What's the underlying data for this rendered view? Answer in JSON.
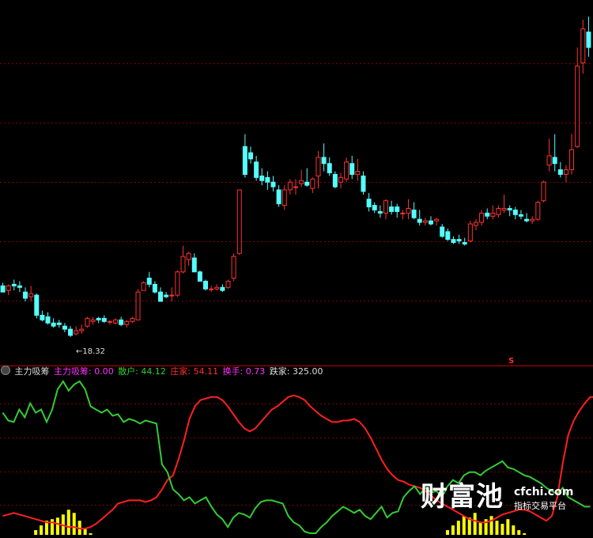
{
  "indicator_label": "主力吸筹",
  "legend": {
    "main_label": "主力吸筹: 0.00",
    "retail_label": "散户: 44.12",
    "dealer_label": "庄家: 54.11",
    "turnover_label": "换手: 0.73",
    "trap_label": "跌家: 325.00"
  },
  "low_marker": "←18.32",
  "signal_marker": "S",
  "watermark": {
    "brand_cn": "财富池",
    "brand_en": "cfchi.com",
    "tagline": "指标交易平台"
  },
  "colors": {
    "up": "#ff3232",
    "down": "#54ffff",
    "retail": "#33cc33",
    "dealer": "#ff2020",
    "bars": "#ffff00",
    "grid": "#800000"
  },
  "chart_data": [
    {
      "type": "candlestick",
      "title": "",
      "ylim": [
        17.5,
        29.0
      ],
      "annotation_low": 18.32,
      "candles": [
        [
          19.92,
          20.02,
          19.72,
          19.72
        ],
        [
          19.77,
          19.97,
          19.62,
          19.92
        ],
        [
          19.97,
          20.12,
          19.77,
          19.92
        ],
        [
          19.92,
          20.07,
          19.72,
          19.87
        ],
        [
          19.72,
          19.87,
          19.42,
          19.52
        ],
        [
          19.57,
          19.92,
          19.42,
          19.67
        ],
        [
          19.62,
          19.67,
          18.87,
          18.97
        ],
        [
          18.97,
          19.12,
          18.77,
          18.82
        ],
        [
          18.92,
          19.07,
          18.67,
          18.72
        ],
        [
          18.72,
          18.87,
          18.57,
          18.62
        ],
        [
          18.72,
          18.82,
          18.57,
          18.67
        ],
        [
          18.62,
          18.72,
          18.42,
          18.52
        ],
        [
          18.52,
          18.62,
          18.27,
          18.32
        ],
        [
          18.37,
          18.62,
          18.32,
          18.47
        ],
        [
          18.47,
          18.67,
          18.37,
          18.52
        ],
        [
          18.62,
          18.92,
          18.57,
          18.87
        ],
        [
          18.77,
          18.92,
          18.67,
          18.82
        ],
        [
          18.87,
          18.92,
          18.72,
          18.82
        ],
        [
          18.87,
          18.97,
          18.72,
          18.77
        ],
        [
          18.77,
          18.82,
          18.67,
          18.77
        ],
        [
          18.72,
          18.87,
          18.67,
          18.82
        ],
        [
          18.82,
          18.92,
          18.62,
          18.67
        ],
        [
          18.67,
          18.82,
          18.57,
          18.77
        ],
        [
          18.77,
          18.92,
          18.72,
          18.87
        ],
        [
          18.82,
          19.82,
          18.82,
          19.72
        ],
        [
          19.77,
          20.07,
          19.77,
          20.02
        ],
        [
          20.17,
          20.37,
          19.87,
          19.97
        ],
        [
          19.97,
          20.07,
          19.67,
          19.72
        ],
        [
          19.72,
          19.87,
          19.42,
          19.42
        ],
        [
          19.62,
          19.72,
          19.52,
          19.57
        ],
        [
          19.62,
          19.87,
          19.42,
          19.62
        ],
        [
          19.62,
          20.42,
          19.57,
          20.37
        ],
        [
          20.37,
          21.22,
          20.32,
          20.87
        ],
        [
          20.77,
          21.02,
          20.57,
          20.97
        ],
        [
          20.82,
          20.97,
          20.47,
          20.37
        ],
        [
          20.37,
          20.42,
          20.07,
          20.07
        ],
        [
          20.07,
          20.12,
          19.77,
          19.82
        ],
        [
          19.82,
          19.92,
          19.72,
          19.82
        ],
        [
          19.82,
          19.97,
          19.77,
          19.87
        ],
        [
          19.87,
          19.97,
          19.72,
          19.77
        ],
        [
          19.87,
          20.12,
          19.82,
          20.07
        ],
        [
          20.17,
          20.97,
          20.07,
          20.87
        ],
        [
          20.97,
          23.02,
          20.92,
          23.02
        ],
        [
          24.42,
          24.82,
          23.42,
          23.52
        ],
        [
          24.22,
          24.42,
          23.87,
          24.02
        ],
        [
          23.92,
          24.12,
          23.32,
          23.42
        ],
        [
          23.47,
          23.72,
          23.17,
          23.32
        ],
        [
          23.42,
          23.62,
          23.02,
          23.27
        ],
        [
          23.27,
          23.47,
          22.97,
          23.12
        ],
        [
          23.02,
          23.17,
          22.47,
          22.57
        ],
        [
          22.52,
          23.17,
          22.37,
          23.02
        ],
        [
          23.02,
          23.37,
          22.87,
          23.27
        ],
        [
          23.12,
          23.37,
          22.87,
          23.12
        ],
        [
          23.22,
          23.67,
          23.12,
          23.32
        ],
        [
          23.27,
          23.72,
          23.12,
          23.17
        ],
        [
          23.07,
          23.42,
          22.92,
          23.37
        ],
        [
          23.47,
          24.27,
          23.07,
          24.07
        ],
        [
          24.07,
          24.52,
          23.62,
          23.87
        ],
        [
          23.87,
          24.07,
          23.47,
          23.57
        ],
        [
          23.52,
          23.62,
          23.07,
          23.12
        ],
        [
          23.27,
          23.57,
          23.07,
          23.42
        ],
        [
          23.37,
          24.07,
          23.27,
          23.92
        ],
        [
          23.87,
          24.12,
          23.37,
          23.52
        ],
        [
          23.52,
          24.02,
          23.32,
          23.62
        ],
        [
          23.47,
          23.62,
          22.87,
          22.97
        ],
        [
          22.72,
          22.92,
          22.32,
          22.47
        ],
        [
          22.52,
          22.62,
          22.27,
          22.37
        ],
        [
          22.32,
          22.52,
          22.12,
          22.27
        ],
        [
          22.27,
          22.72,
          22.07,
          22.67
        ],
        [
          22.47,
          22.67,
          22.22,
          22.32
        ],
        [
          22.47,
          22.57,
          22.12,
          22.32
        ],
        [
          22.27,
          22.37,
          22.07,
          22.27
        ],
        [
          22.27,
          22.72,
          22.07,
          22.42
        ],
        [
          22.37,
          22.62,
          22.07,
          22.12
        ],
        [
          22.07,
          22.37,
          21.87,
          21.97
        ],
        [
          21.97,
          22.12,
          21.87,
          22.02
        ],
        [
          22.02,
          22.17,
          21.87,
          21.92
        ],
        [
          22.02,
          22.12,
          21.87,
          22.07
        ],
        [
          21.82,
          21.92,
          21.47,
          21.52
        ],
        [
          21.67,
          21.77,
          21.37,
          21.42
        ],
        [
          21.42,
          21.52,
          21.27,
          21.32
        ],
        [
          21.42,
          21.57,
          21.27,
          21.37
        ],
        [
          21.32,
          21.47,
          21.22,
          21.27
        ],
        [
          21.37,
          22.02,
          21.32,
          21.92
        ],
        [
          21.87,
          22.07,
          21.72,
          21.97
        ],
        [
          21.97,
          22.37,
          21.87,
          22.27
        ],
        [
          22.27,
          22.42,
          22.07,
          22.17
        ],
        [
          22.17,
          22.52,
          22.07,
          22.27
        ],
        [
          22.22,
          22.52,
          22.12,
          22.42
        ],
        [
          22.37,
          22.87,
          22.27,
          22.42
        ],
        [
          22.42,
          22.52,
          22.17,
          22.37
        ],
        [
          22.37,
          22.47,
          22.07,
          22.22
        ],
        [
          22.22,
          22.37,
          22.07,
          22.17
        ],
        [
          22.07,
          22.27,
          21.97,
          22.02
        ],
        [
          22.02,
          22.17,
          21.92,
          22.07
        ],
        [
          22.07,
          22.67,
          22.02,
          22.62
        ],
        [
          22.67,
          23.32,
          22.62,
          23.27
        ],
        [
          23.82,
          24.67,
          23.62,
          24.12
        ],
        [
          24.07,
          24.82,
          23.62,
          23.87
        ],
        [
          23.67,
          23.92,
          23.42,
          23.52
        ],
        [
          23.52,
          23.82,
          23.27,
          23.67
        ],
        [
          23.67,
          24.82,
          23.52,
          24.32
        ],
        [
          24.42,
          27.62,
          24.37,
          27.02
        ],
        [
          27.12,
          28.52,
          26.77,
          28.22
        ],
        [
          28.12,
          28.62,
          27.32,
          27.62
        ]
      ]
    },
    {
      "type": "line",
      "title": "主力吸筹",
      "ylim": [
        0,
        100
      ],
      "series": [
        {
          "name": "散户",
          "values": [
            78,
            73,
            72,
            80,
            75,
            84,
            78,
            80,
            72,
            80,
            93,
            98,
            92,
            96,
            98,
            93,
            82,
            80,
            78,
            80,
            76,
            77,
            72,
            74,
            73,
            71,
            73,
            72,
            71,
            45,
            40,
            29,
            26,
            22,
            24,
            20,
            22,
            24,
            18,
            13,
            10,
            5,
            11,
            14,
            13,
            11,
            17,
            21,
            22,
            22,
            21,
            20,
            12,
            8,
            6,
            2,
            1,
            1,
            5,
            8,
            12,
            15,
            18,
            16,
            14,
            16,
            12,
            10,
            14,
            18,
            11,
            14,
            15,
            24,
            28,
            31,
            26,
            30,
            27,
            28,
            24,
            31,
            35,
            33,
            38,
            40,
            40,
            38,
            41,
            43,
            45,
            47,
            43,
            42,
            40,
            38,
            37,
            35,
            33,
            30,
            28,
            26,
            30,
            24,
            22,
            20,
            18,
            18
          ]
        },
        {
          "name": "庄家",
          "values": [
            12,
            13,
            14,
            13,
            12,
            11,
            10,
            9,
            8,
            8,
            7,
            6,
            5,
            5,
            4,
            4,
            5,
            7,
            10,
            13,
            16,
            20,
            21,
            22,
            22,
            22,
            21,
            22,
            24,
            29,
            35,
            38,
            48,
            60,
            74,
            82,
            86,
            87,
            88,
            88,
            86,
            82,
            77,
            72,
            68,
            66,
            68,
            72,
            76,
            80,
            82,
            85,
            88,
            89,
            88,
            86,
            82,
            79,
            76,
            74,
            72,
            72,
            73,
            73,
            74,
            72,
            68,
            62,
            55,
            48,
            42,
            38,
            35,
            34,
            32,
            31,
            30,
            28,
            25,
            22,
            20,
            18,
            16,
            14,
            12,
            10,
            9,
            8,
            8,
            9,
            11,
            13,
            14,
            15,
            16,
            16,
            15,
            13,
            11,
            9,
            12,
            24,
            46,
            64,
            73,
            79,
            84,
            88,
            88
          ]
        },
        {
          "name": "主力吸筹",
          "values": [
            0,
            0,
            0,
            0,
            0,
            0,
            3,
            6,
            9,
            10,
            11,
            13,
            16,
            14,
            9,
            4,
            1,
            0,
            0,
            0,
            0,
            0,
            0,
            0,
            0,
            0,
            0,
            0,
            0,
            0,
            0,
            0,
            0,
            0,
            0,
            0,
            0,
            0,
            0,
            0,
            0,
            0,
            0,
            0,
            0,
            0,
            0,
            0,
            0,
            0,
            0,
            0,
            0,
            0,
            0,
            0,
            0,
            0,
            0,
            0,
            0,
            0,
            0,
            0,
            0,
            0,
            0,
            0,
            0,
            0,
            0,
            0,
            0,
            0,
            0,
            0,
            0,
            0,
            0,
            0,
            0,
            3,
            6,
            9,
            12,
            11,
            14,
            8,
            10,
            12,
            9,
            7,
            10,
            6,
            3,
            1,
            0,
            0,
            0,
            0,
            0,
            0,
            0,
            0,
            0,
            0,
            0,
            0
          ]
        }
      ]
    }
  ]
}
